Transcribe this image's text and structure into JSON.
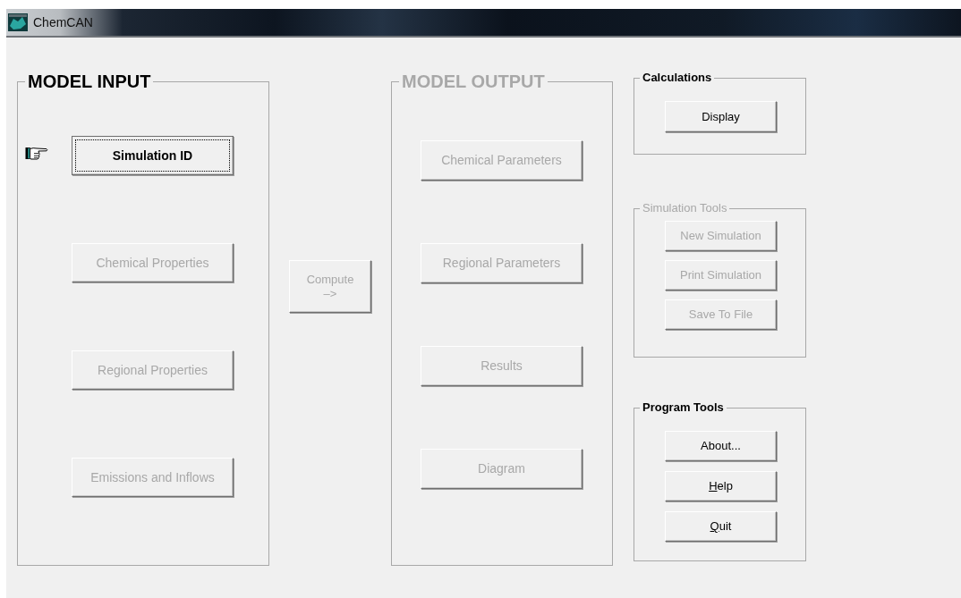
{
  "window": {
    "title": "ChemCAN"
  },
  "model_input": {
    "title": "MODEL INPUT",
    "disabled": false,
    "buttons": [
      {
        "label": "Simulation ID",
        "disabled": false,
        "focused": true
      },
      {
        "label": "Chemical Properties",
        "disabled": true,
        "focused": false
      },
      {
        "label": "Regional Properties",
        "disabled": true,
        "focused": false
      },
      {
        "label": "Emissions and Inflows",
        "disabled": true,
        "focused": false
      }
    ]
  },
  "compute": {
    "label": "Compute",
    "arrow": "–>",
    "disabled": true
  },
  "model_output": {
    "title": "MODEL OUTPUT",
    "disabled": true,
    "buttons": [
      {
        "label": "Chemical Parameters",
        "disabled": true
      },
      {
        "label": "Regional  Parameters",
        "disabled": true
      },
      {
        "label": "Results",
        "disabled": true
      },
      {
        "label": "Diagram",
        "disabled": true
      }
    ]
  },
  "calculations": {
    "title": "Calculations",
    "disabled": false,
    "buttons": [
      {
        "label": "Display",
        "disabled": false
      }
    ]
  },
  "simulation_tools": {
    "title": "Simulation Tools",
    "disabled": true,
    "buttons": [
      {
        "label": "New Simulation",
        "disabled": true
      },
      {
        "label": "Print Simulation",
        "disabled": true
      },
      {
        "label": "Save To File",
        "disabled": true
      }
    ]
  },
  "program_tools": {
    "title": "Program Tools",
    "disabled": false,
    "buttons": [
      {
        "label": "About...",
        "disabled": false
      },
      {
        "label": "Help",
        "disabled": false,
        "underline_first": true
      },
      {
        "label": "Quit",
        "disabled": false,
        "underline_first": true
      }
    ]
  }
}
